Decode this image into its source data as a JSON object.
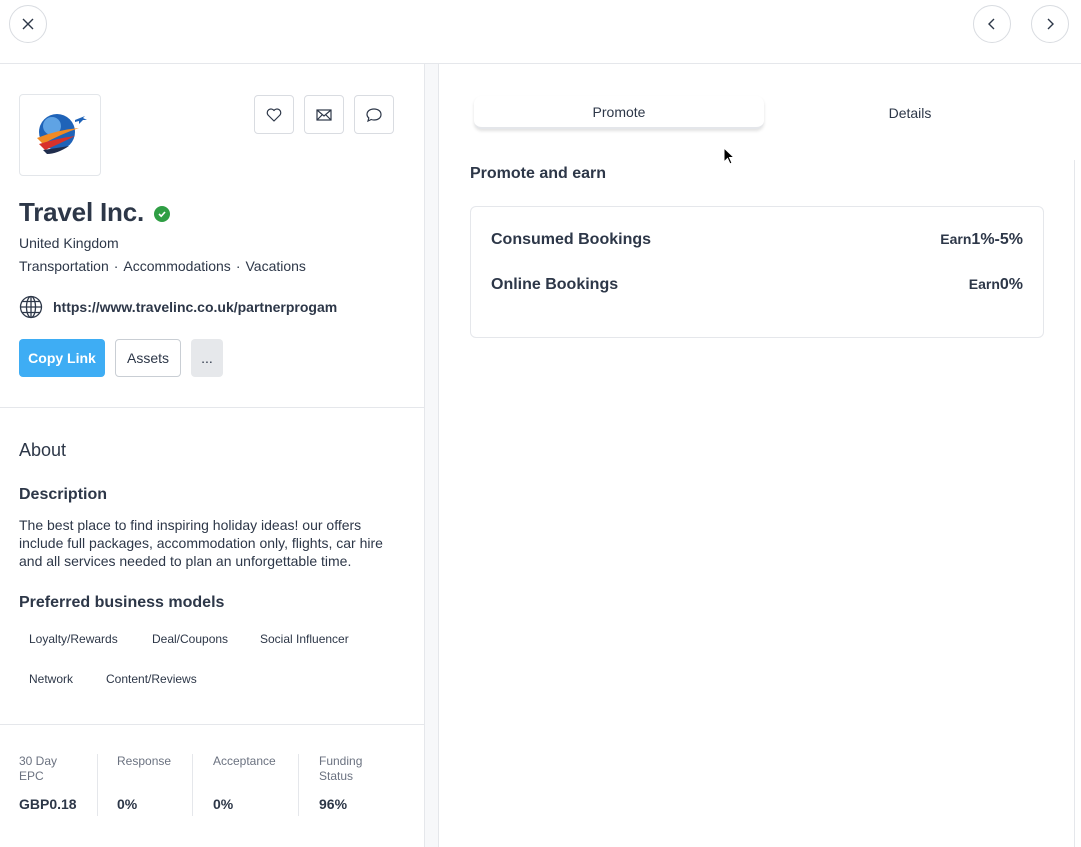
{
  "topbar": {
    "close_icon": "close-icon",
    "prev_icon": "chevron-left-icon",
    "next_icon": "chevron-right-icon"
  },
  "profile": {
    "name": "Travel Inc.",
    "verified": true,
    "country": "United Kingdom",
    "categories": [
      "Transportation",
      "Accommodations",
      "Vacations"
    ],
    "url": "https://www.travelinc.co.uk/partnerprogam",
    "actions": {
      "favorite_icon": "heart-icon",
      "email_icon": "mail-icon",
      "message_icon": "chat-icon"
    },
    "buttons": {
      "copy_link": "Copy Link",
      "assets": "Assets",
      "more": "..."
    }
  },
  "about": {
    "heading": "About",
    "description_heading": "Description",
    "description": "The best place to find inspiring holiday ideas! our offers include full packages, accommodation only, flights, car hire and all services needed to plan an unforgettable time.",
    "models_heading": "Preferred business models",
    "models": [
      "Loyalty/Rewards",
      "Deal/Coupons",
      "Social Influencer",
      "Network",
      "Content/Reviews"
    ]
  },
  "stats": [
    {
      "label": "30 Day EPC",
      "value": "GBP0.18"
    },
    {
      "label": "Response",
      "value": "0%"
    },
    {
      "label": "Acceptance",
      "value": "0%"
    },
    {
      "label": "Funding Status",
      "value": "96%"
    }
  ],
  "tabs": [
    {
      "label": "Promote",
      "active": true
    },
    {
      "label": "Details",
      "active": false
    }
  ],
  "promote": {
    "heading": "Promote and earn",
    "rows": [
      {
        "label": "Consumed Bookings",
        "earn_prefix": "Earn",
        "earn_value": "1%-5%"
      },
      {
        "label": "Online Bookings",
        "earn_prefix": "Earn",
        "earn_value": "0%"
      }
    ]
  },
  "colors": {
    "accent": "#3eadf4",
    "verified": "#2f9e44",
    "text": "#2d3748"
  }
}
